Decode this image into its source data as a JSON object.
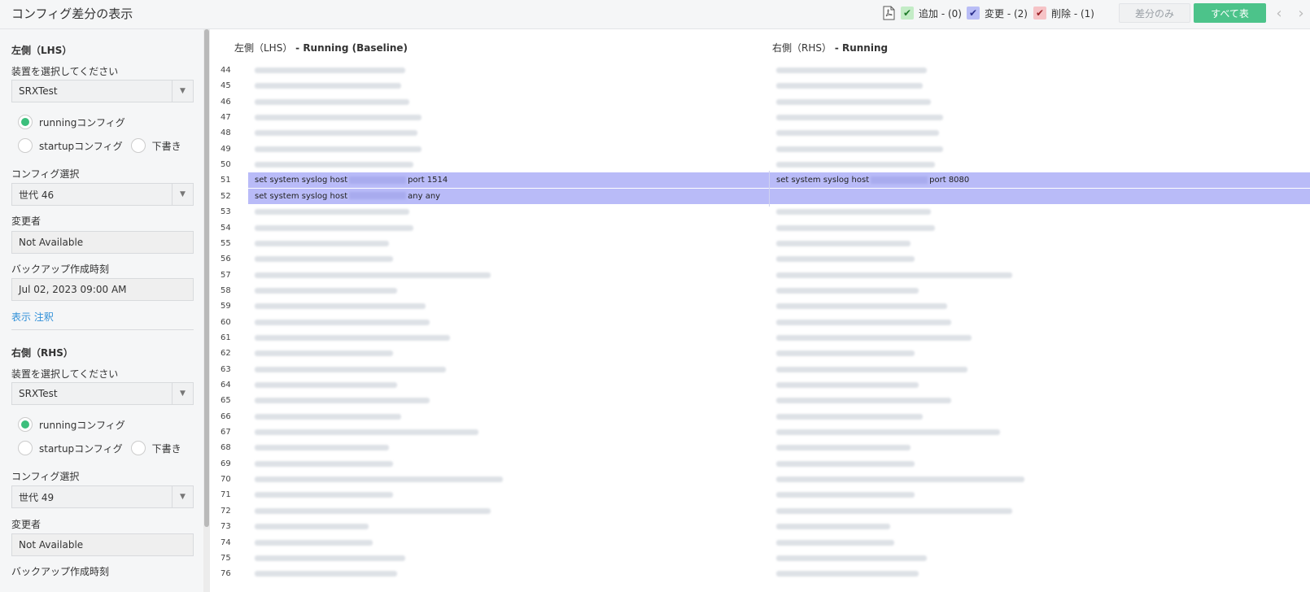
{
  "header": {
    "title": "コンフィグ差分の表示",
    "legend": {
      "added": "追加 - (0)",
      "changed": "変更 - (2)",
      "deleted": "削除 - (1)"
    },
    "btn_diff_only": "差分のみ",
    "btn_show_all": "すべて表",
    "nav_prev": "‹",
    "nav_next": "›",
    "colors": {
      "added": "#c3ecc6",
      "changed": "#b9bdf6",
      "deleted": "#f6c3c6",
      "primary": "#4cc38a"
    }
  },
  "sidebar": {
    "lhs": {
      "title": "左側（LHS）",
      "device_label": "装置を選択してください",
      "device_value": "SRXTest",
      "radio_running": "runningコンフィグ",
      "radio_startup": "startupコンフィグ",
      "radio_draft": "下書き",
      "config_label": "コンフィグ選択",
      "config_value": "世代 46",
      "changer_label": "変更者",
      "changer_value": "Not Available",
      "backup_label": "バックアップ作成時刻",
      "backup_value": "Jul 02, 2023 09:00 AM",
      "link": "表示 注釈"
    },
    "rhs": {
      "title": "右側（RHS）",
      "device_label": "装置を選択してください",
      "device_value": "SRXTest",
      "radio_running": "runningコンフィグ",
      "radio_startup": "startupコンフィグ",
      "radio_draft": "下書き",
      "config_label": "コンフィグ選択",
      "config_value": "世代 49",
      "changer_label": "変更者",
      "changer_value": "Not Available",
      "backup_label": "バックアップ作成時刻"
    }
  },
  "main": {
    "lhs_header_prefix": "左側（LHS）",
    "lhs_header_bold": "- Running (Baseline)",
    "rhs_header_prefix": "右側（RHS）",
    "rhs_header_bold": "- Running",
    "line_numbers": [
      "44",
      "45",
      "46",
      "47",
      "48",
      "49",
      "50",
      "51",
      "52",
      "53",
      "54",
      "55",
      "56",
      "57",
      "58",
      "59",
      "60",
      "61",
      "62",
      "63",
      "64",
      "65",
      "66",
      "67",
      "68",
      "69",
      "70",
      "71",
      "72",
      "73",
      "74",
      "75",
      "76"
    ],
    "changed": {
      "l51_a": "set system syslog host",
      "l51_b": "port 1514",
      "l52_a": "set system syslog host",
      "l52_b": "any any",
      "r51_a": "set system syslog host",
      "r51_b": "port 8080"
    }
  }
}
